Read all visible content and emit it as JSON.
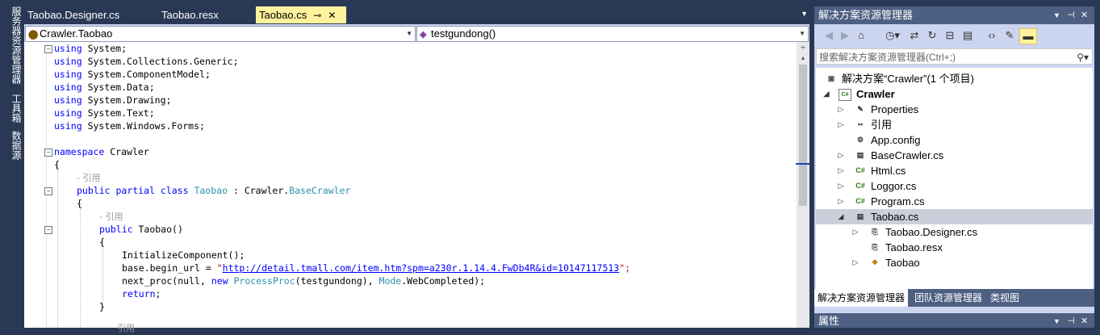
{
  "left_strip": {
    "server_explorer": "服务器资源管理器",
    "toolbox": "工具箱",
    "data_sources": "数据源"
  },
  "tabs": [
    {
      "label": "Taobao.Designer.cs",
      "active": false
    },
    {
      "label": "Taobao.resx",
      "active": false
    },
    {
      "label": "Taobao.cs",
      "active": true
    }
  ],
  "tab_controls": {
    "pin": "⊸",
    "close": "✕",
    "dropdown": "▼"
  },
  "navbar": {
    "class_selector": "Crawler.Taobao",
    "member_selector": "testgundong()"
  },
  "code": {
    "l1": "System;",
    "l2": "System.Collections.Generic;",
    "l3": "System.ComponentModel;",
    "l4": "System.Data;",
    "l5": "System.Drawing;",
    "l6": "System.Text;",
    "l7": "System.Windows.Forms;",
    "kw_using": "using",
    "kw_namespace": "namespace",
    "ns_name": "Crawler",
    "brace_open": "{",
    "brace_close": "}",
    "ref_hint": "- 引用",
    "kw_public": "public",
    "kw_partial": "partial",
    "kw_class": "class",
    "class_name": "Taobao",
    "colon": ":",
    "base_ns": "Crawler.",
    "base_class": "BaseCrawler",
    "ctor": "Taobao()",
    "init": "InitializeComponent();",
    "begin_url_pre": "base.begin_url = ",
    "q1": "\"",
    "url": "http://detail.tmall.com/item.htm?spm=a230r.1.14.4.FwDb4R&id=10147117513",
    "q2": "\";",
    "next_proc_pre": "next_proc(null, ",
    "kw_new": "new",
    "proc_type": "ProcessProc",
    "proc_args": "(testgundong), ",
    "mode_type": "Mode",
    "mode_rest": ".WebCompleted);",
    "kw_return": "return",
    "semicolon": ";",
    "ref_hint2": "引用"
  },
  "solution_explorer": {
    "title": "解决方案资源管理器",
    "title_controls": {
      "dropdown": "▼",
      "pin": "⊣",
      "close": "✕"
    },
    "search_placeholder": "搜索解决方案资源管理器(Ctrl+;)",
    "tree": [
      {
        "label": "解决方案“Crawler”(1 个项目)",
        "icon": "solution-icon"
      },
      {
        "label": "Crawler",
        "icon": "csharp-project-icon",
        "bold": true
      },
      {
        "label": "Properties",
        "icon": "wrench-icon"
      },
      {
        "label": "引用",
        "icon": "references-icon"
      },
      {
        "label": "App.config",
        "icon": "config-file-icon"
      },
      {
        "label": "BaseCrawler.cs",
        "icon": "form-file-icon"
      },
      {
        "label": "Html.cs",
        "icon": "csharp-file-icon"
      },
      {
        "label": "Loggor.cs",
        "icon": "csharp-file-icon"
      },
      {
        "label": "Program.cs",
        "icon": "csharp-file-icon"
      },
      {
        "label": "Taobao.cs",
        "icon": "form-file-icon",
        "selected": true
      },
      {
        "label": "Taobao.Designer.cs",
        "icon": "designer-file-icon"
      },
      {
        "label": "Taobao.resx",
        "icon": "resx-file-icon"
      },
      {
        "label": "Taobao",
        "icon": "class-icon"
      }
    ],
    "bottom_tabs": [
      {
        "label": "解决方案资源管理器",
        "active": true
      },
      {
        "label": "团队资源管理器",
        "active": false
      },
      {
        "label": "类视图",
        "active": false
      }
    ],
    "properties_title": "属性"
  },
  "colors": {
    "chrome": "#293955",
    "active_tab": "#FFF29D",
    "keyword": "#0000ff",
    "type": "#2b91af",
    "string": "#a31515",
    "selection": "#CCCEDB"
  }
}
